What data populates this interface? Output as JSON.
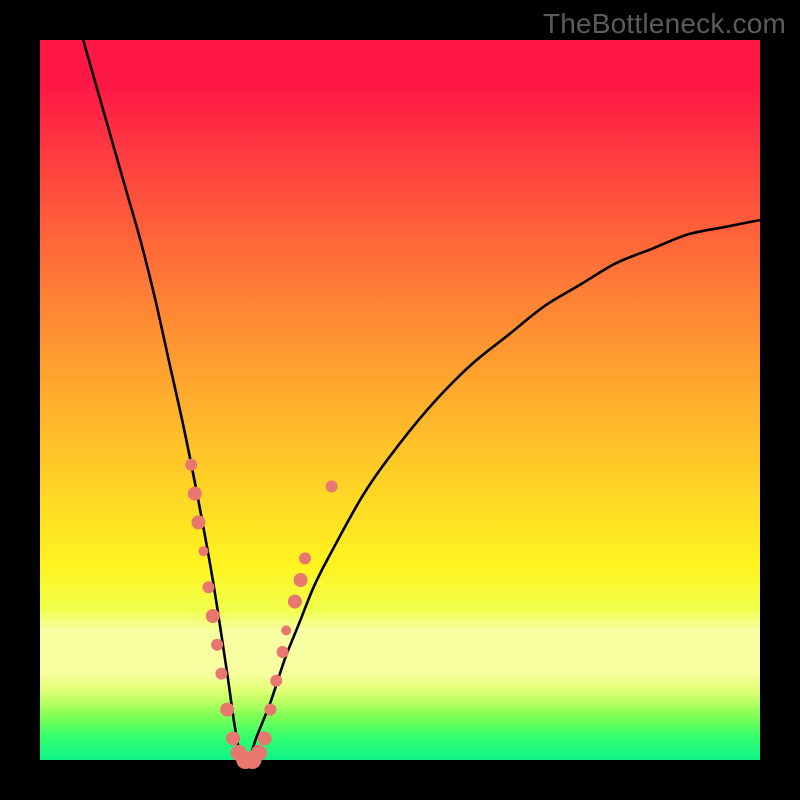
{
  "watermark": "TheBottleneck.com",
  "colors": {
    "page_bg": "#000000",
    "curve": "#000000",
    "marker": "#e8776f",
    "gradient_top": "#ff1746",
    "gradient_bottom": "#10f387"
  },
  "chart_data": {
    "type": "line",
    "title": "",
    "xlabel": "",
    "ylabel": "",
    "xlim": [
      0,
      100
    ],
    "ylim": [
      0,
      100
    ],
    "grid": false,
    "legend": false,
    "notes": "V-shaped bottleneck curve; y decreases to 0 at x≈28 then rises toward ~75 at x=100. No axis ticks or numeric labels are rendered.",
    "series": [
      {
        "name": "bottleneck_curve",
        "x": [
          6,
          8,
          10,
          12,
          14,
          16,
          18,
          20,
          22,
          24,
          26,
          27,
          28,
          29,
          30,
          32,
          34,
          36,
          38,
          40,
          45,
          50,
          55,
          60,
          65,
          70,
          75,
          80,
          85,
          90,
          95,
          100
        ],
        "y": [
          100,
          93,
          86,
          79,
          72,
          64,
          55,
          46,
          36,
          25,
          12,
          5,
          0,
          0,
          3,
          8,
          14,
          19,
          24,
          28,
          37,
          44,
          50,
          55,
          59,
          63,
          66,
          69,
          71,
          73,
          74,
          75
        ]
      }
    ],
    "markers": [
      {
        "x": 21.0,
        "y": 41,
        "r": 6
      },
      {
        "x": 21.5,
        "y": 37,
        "r": 7
      },
      {
        "x": 22.0,
        "y": 33,
        "r": 7
      },
      {
        "x": 22.7,
        "y": 29,
        "r": 5
      },
      {
        "x": 23.4,
        "y": 24,
        "r": 6
      },
      {
        "x": 24.0,
        "y": 20,
        "r": 7
      },
      {
        "x": 24.6,
        "y": 16,
        "r": 6
      },
      {
        "x": 25.2,
        "y": 12,
        "r": 6
      },
      {
        "x": 26.0,
        "y": 7,
        "r": 7
      },
      {
        "x": 26.8,
        "y": 3,
        "r": 7
      },
      {
        "x": 27.6,
        "y": 1,
        "r": 8
      },
      {
        "x": 28.5,
        "y": 0,
        "r": 9
      },
      {
        "x": 29.5,
        "y": 0,
        "r": 9
      },
      {
        "x": 30.4,
        "y": 1,
        "r": 8
      },
      {
        "x": 31.2,
        "y": 3,
        "r": 7
      },
      {
        "x": 32.0,
        "y": 7,
        "r": 6
      },
      {
        "x": 32.8,
        "y": 11,
        "r": 6
      },
      {
        "x": 33.7,
        "y": 15,
        "r": 6
      },
      {
        "x": 34.2,
        "y": 18,
        "r": 5
      },
      {
        "x": 35.4,
        "y": 22,
        "r": 7
      },
      {
        "x": 36.2,
        "y": 25,
        "r": 7
      },
      {
        "x": 36.8,
        "y": 28,
        "r": 6
      },
      {
        "x": 40.5,
        "y": 38,
        "r": 6
      }
    ]
  }
}
